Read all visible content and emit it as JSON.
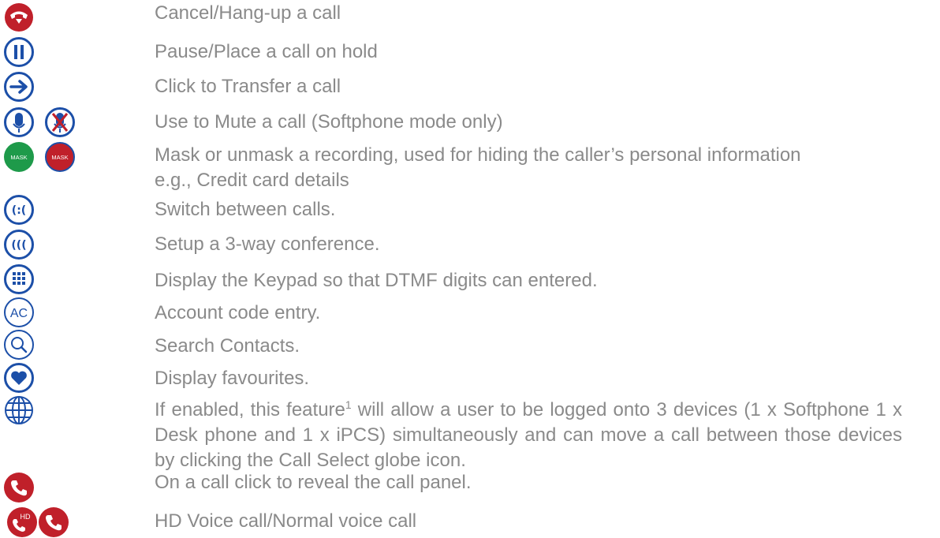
{
  "legend": [
    {
      "icon": "hang-up-icon",
      "text": "Cancel/Hang-up a call"
    },
    {
      "icon": "pause-icon",
      "text": "Pause/Place a call on hold"
    },
    {
      "icon": "transfer-icon",
      "text": "Click to Transfer a call"
    },
    {
      "icon": "mute-icon",
      "text": "Use to Mute a call (Softphone mode only)"
    },
    {
      "icon": "mask-icon",
      "text": "Mask or unmask a recording, used for hiding the caller’s personal information e.g., Credit card details",
      "mask_label": "MASK"
    },
    {
      "icon": "switch-calls-icon",
      "text": "Switch between calls."
    },
    {
      "icon": "conference-icon",
      "text": "Setup a 3-way conference."
    },
    {
      "icon": "keypad-icon",
      "text": "Display the Keypad so that DTMF digits can entered."
    },
    {
      "icon": "account-code-icon",
      "text": "Account code entry.",
      "icon_label": "AC"
    },
    {
      "icon": "search-icon",
      "text": "Search Contacts."
    },
    {
      "icon": "favourites-icon",
      "text": "Display favourites."
    },
    {
      "icon": "globe-icon",
      "text_before": "If enabled, this feature",
      "footnote": "1",
      "text_after": " will allow a user to be logged onto 3 devices (1 x Softphone 1 x Desk phone and 1 x iPCS) simultaneously and can move a call between those devices by clicking the Call Select globe icon."
    },
    {
      "icon": "call-panel-icon",
      "text": "On a call click to reveal the call panel."
    },
    {
      "icon": "hd-voice-icon",
      "text": "HD Voice call/Normal voice call",
      "icon_label": "HD"
    }
  ],
  "colors": {
    "blue": "#1c4fa8",
    "red": "#c0202a",
    "green": "#1e9a4a",
    "text": "#8a8a8a"
  }
}
